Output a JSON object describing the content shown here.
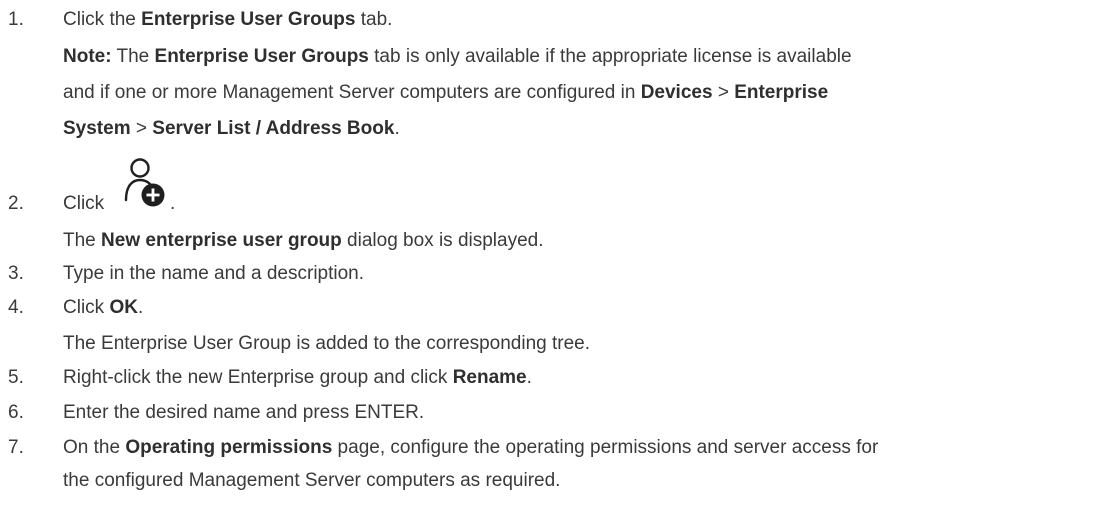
{
  "steps": [
    {
      "num": "1.",
      "line1_pre": "Click the ",
      "line1_bold": "Enterprise User Groups",
      "line1_post": " tab.",
      "note_label": "Note:",
      "note_pre": " The ",
      "note_bold": "Enterprise User Groups",
      "note_post": " tab is only available if the appropriate license is available",
      "note_line2_pre": "and if one or more Management Server computers are configured in ",
      "note_line2_b1": "Devices",
      "note_line2_sep1": " > ",
      "note_line2_b2": "Enterprise",
      "note_line3_b1": "System",
      "note_line3_sep": " > ",
      "note_line3_b2": "Server List / Address Book",
      "note_line3_post": "."
    },
    {
      "num": "2.",
      "line1": "Click",
      "line1_post": ".",
      "icon": "add-user-icon",
      "line2_pre": "The ",
      "line2_bold": "New enterprise user group",
      "line2_post": " dialog box is displayed."
    },
    {
      "num": "3.",
      "line1": "Type in the name and a description."
    },
    {
      "num": "4.",
      "line1_pre": "Click ",
      "line1_bold": "OK",
      "line1_post": ".",
      "line2": "The Enterprise User Group is added to the corresponding tree."
    },
    {
      "num": "5.",
      "line1_pre": "Right-click the new Enterprise group and click ",
      "line1_bold": "Rename",
      "line1_post": "."
    },
    {
      "num": "6.",
      "line1": "Enter the desired name and press ENTER."
    },
    {
      "num": "7.",
      "line1_pre": "On the ",
      "line1_bold": "Operating permissions",
      "line1_post": " page, configure the operating permissions and server access for",
      "line2": "the configured Management Server computers as required."
    }
  ]
}
